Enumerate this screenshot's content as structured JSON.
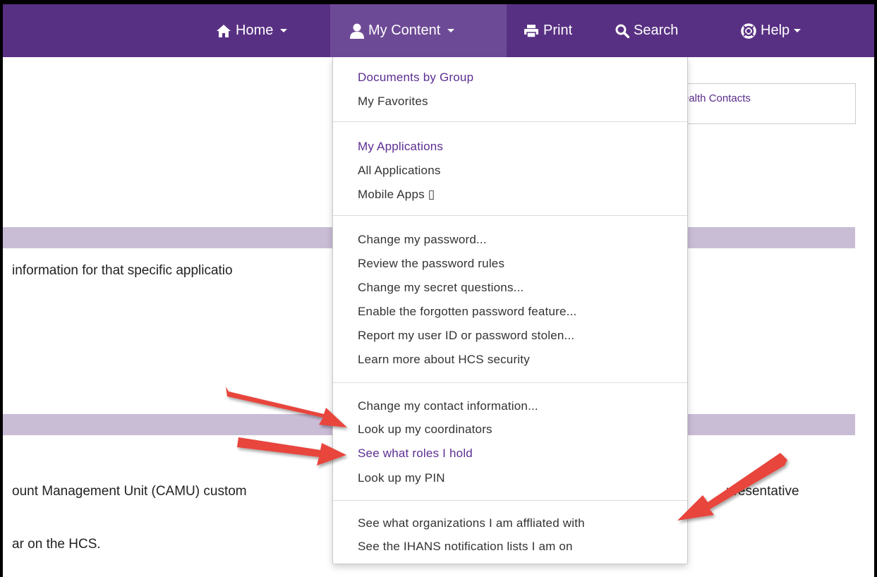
{
  "navbar": {
    "items": [
      {
        "label": "Home",
        "icon": "home-icon",
        "has_caret": true
      },
      {
        "label": "My Content",
        "icon": "user-icon",
        "has_caret": true,
        "active": true
      },
      {
        "label": "Print",
        "icon": "print-icon",
        "has_caret": false
      },
      {
        "label": "Search",
        "icon": "search-icon",
        "has_caret": false
      },
      {
        "label": "Help",
        "icon": "lifebuoy-icon",
        "has_caret": true
      }
    ]
  },
  "background": {
    "info_box_text": "ealth Contacts",
    "text_line_1": "information for that specific applicatio",
    "text_line_2_left": "ount Management Unit (CAMU) custom",
    "text_line_2_right": "presentative",
    "text_line_3": "ar on the HCS."
  },
  "dropdown": {
    "groups": [
      {
        "items": [
          {
            "label": "Documents by Group",
            "style": "purple"
          },
          {
            "label": "My Favorites",
            "style": "normal"
          }
        ]
      },
      {
        "items": [
          {
            "label": "My Applications",
            "style": "purple"
          },
          {
            "label": "All Applications",
            "style": "normal"
          },
          {
            "label": "Mobile Apps ▯",
            "style": "normal"
          }
        ]
      },
      {
        "items": [
          {
            "label": "Change my password...",
            "style": "normal"
          },
          {
            "label": "Review the password rules",
            "style": "normal"
          },
          {
            "label": "Change my secret questions...",
            "style": "normal"
          },
          {
            "label": "Enable the forgotten password feature...",
            "style": "normal"
          },
          {
            "label": "Report my user ID or password stolen...",
            "style": "normal"
          },
          {
            "label": "Learn more about HCS security",
            "style": "normal"
          }
        ]
      },
      {
        "items": [
          {
            "label": "Change my contact information...",
            "style": "normal"
          },
          {
            "label": "Look up my coordinators",
            "style": "normal"
          },
          {
            "label": "See what roles I hold",
            "style": "purple"
          },
          {
            "label": "Look up my PIN",
            "style": "normal"
          }
        ]
      },
      {
        "items": [
          {
            "label": "See what organizations I am affliated with",
            "style": "normal"
          },
          {
            "label": "See the IHANS notification lists I am on",
            "style": "normal"
          }
        ]
      }
    ]
  },
  "colors": {
    "navbar_bg": "#583083",
    "navbar_active": "#6d4a95",
    "band": "#c9bdd6",
    "link_purple": "#5c2e91",
    "arrow_red": "#e8453c"
  }
}
